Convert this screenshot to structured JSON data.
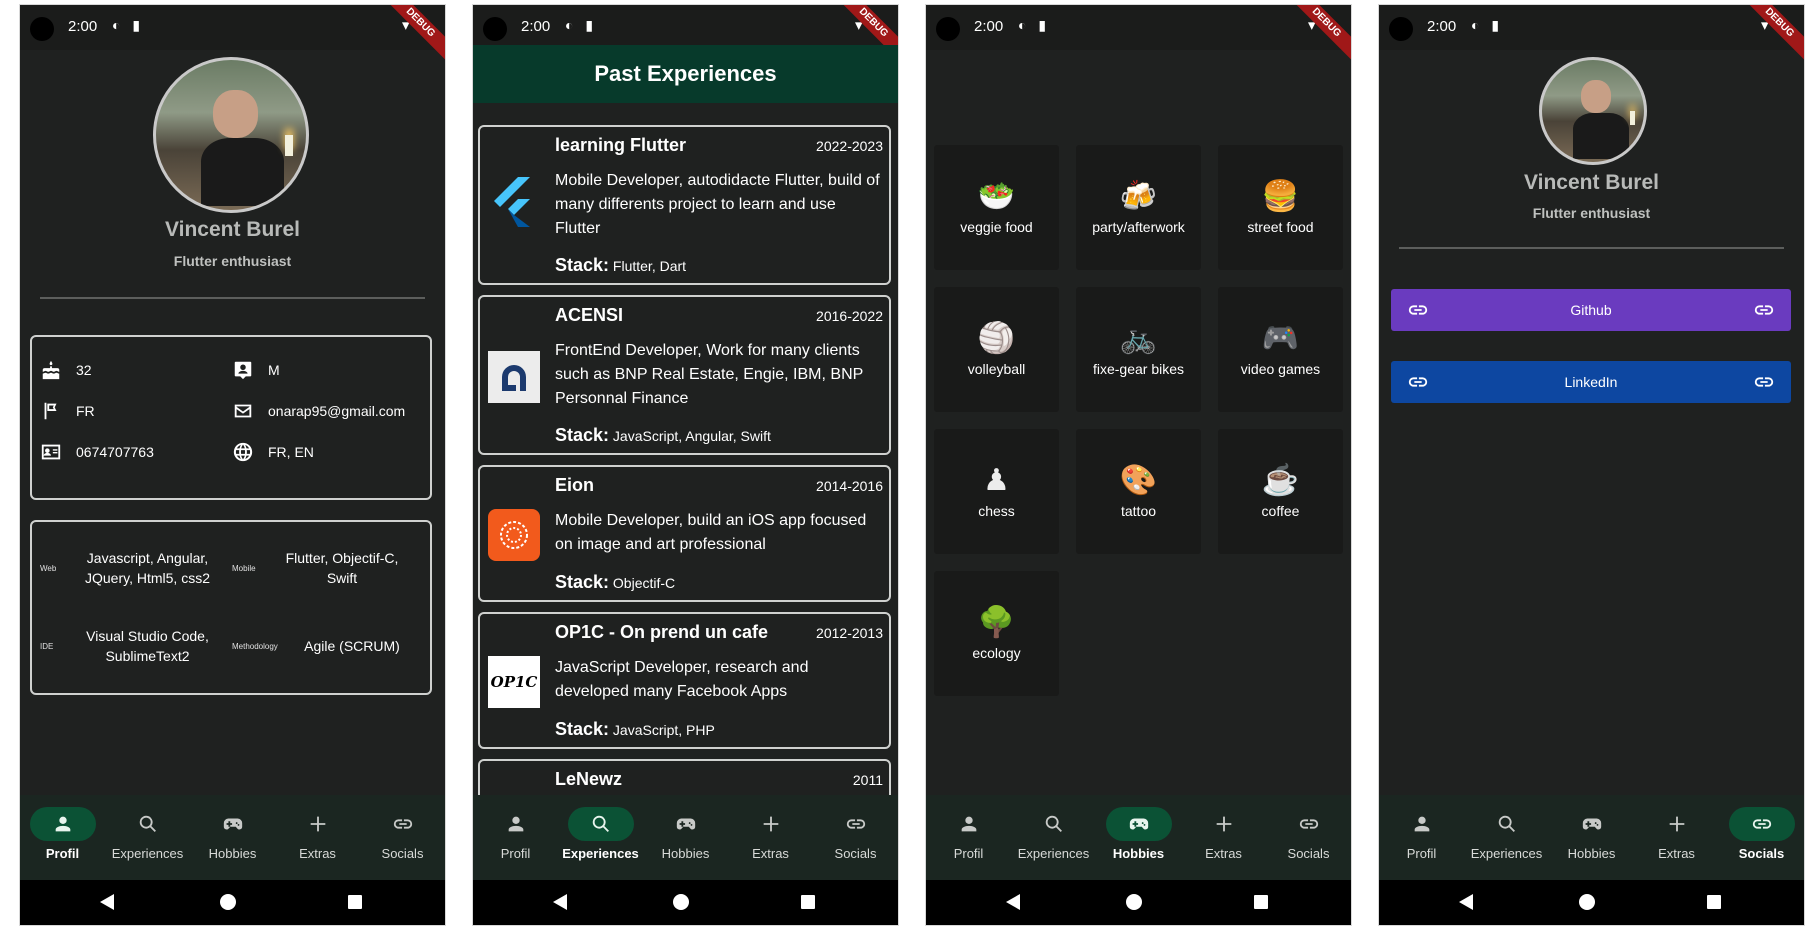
{
  "status": {
    "time": "2:00"
  },
  "debug": "DEBUG",
  "nav": {
    "profil": "Profil",
    "experiences": "Experiences",
    "hobbies": "Hobbies",
    "extras": "Extras",
    "socials": "Socials"
  },
  "profile": {
    "name": "Vincent Burel",
    "tagline": "Flutter enthusiast",
    "age": "32",
    "gender": "M",
    "country": "FR",
    "email": "onarap95@gmail.com",
    "phone": "0674707763",
    "languages": "FR, EN",
    "skills": [
      {
        "category": "Web",
        "value": "Javascript, Angular, JQuery, Html5, css2"
      },
      {
        "category": "Mobile",
        "value": "Flutter, Objectif-C, Swift"
      },
      {
        "category": "IDE",
        "value": "Visual Studio Code, SublimeText2"
      },
      {
        "category": "Methodology",
        "value": "Agile (SCRUM)"
      }
    ]
  },
  "experiences": {
    "title": "Past Experiences",
    "stack_label": "Stack:",
    "items": [
      {
        "title": "learning Flutter",
        "years": "2022-2023",
        "description": "Mobile Developer, autodidacte Flutter, build of many differents project to learn and use Flutter",
        "stack": "Flutter, Dart"
      },
      {
        "title": "ACENSI",
        "years": "2016-2022",
        "description": "FrontEnd Developer, Work for many clients such as BNP Real Estate, Engie, IBM, BNP Personnal Finance",
        "stack": "JavaScript, Angular, Swift"
      },
      {
        "title": "Eion",
        "years": "2014-2016",
        "description": "Mobile Developer, build an iOS app focused on image and art professional",
        "stack": "Objectif-C"
      },
      {
        "title": "OP1C - On prend un cafe",
        "years": "2012-2013",
        "description": "JavaScript Developer, research and developed many Facebook Apps",
        "stack": "JavaScript, PHP"
      },
      {
        "title": "LeNewz",
        "years": "2011",
        "description": "",
        "stack": ""
      }
    ],
    "op1c_logo_text": "OP1C"
  },
  "hobbies": [
    {
      "label": "veggie food",
      "icon": "salad-emoji",
      "glyph": "🥗"
    },
    {
      "label": "party/afterwork",
      "icon": "beer-emoji",
      "glyph": "🍻"
    },
    {
      "label": "street food",
      "icon": "burger-emoji",
      "glyph": "🍔"
    },
    {
      "label": "volleyball",
      "icon": "volleyball-emoji",
      "glyph": "🏐"
    },
    {
      "label": "fixe-gear bikes",
      "icon": "bike-emoji",
      "glyph": "🚲"
    },
    {
      "label": "video games",
      "icon": "gamepad-emoji",
      "glyph": "🎮"
    },
    {
      "label": "chess",
      "icon": "chess-emoji",
      "glyph": "♟"
    },
    {
      "label": "tattoo",
      "icon": "palette-emoji",
      "glyph": "🎨"
    },
    {
      "label": "coffee",
      "icon": "coffee-emoji",
      "glyph": "☕"
    },
    {
      "label": "ecology",
      "icon": "tree-emoji",
      "glyph": "🌳"
    }
  ],
  "socials": [
    {
      "label": "Github",
      "color": "#6a3bbf"
    },
    {
      "label": "LinkedIn",
      "color": "#0d47a1"
    }
  ],
  "colors": {
    "accent": "#0b5235",
    "appbar": "#073a2b",
    "background": "#1f2120"
  }
}
